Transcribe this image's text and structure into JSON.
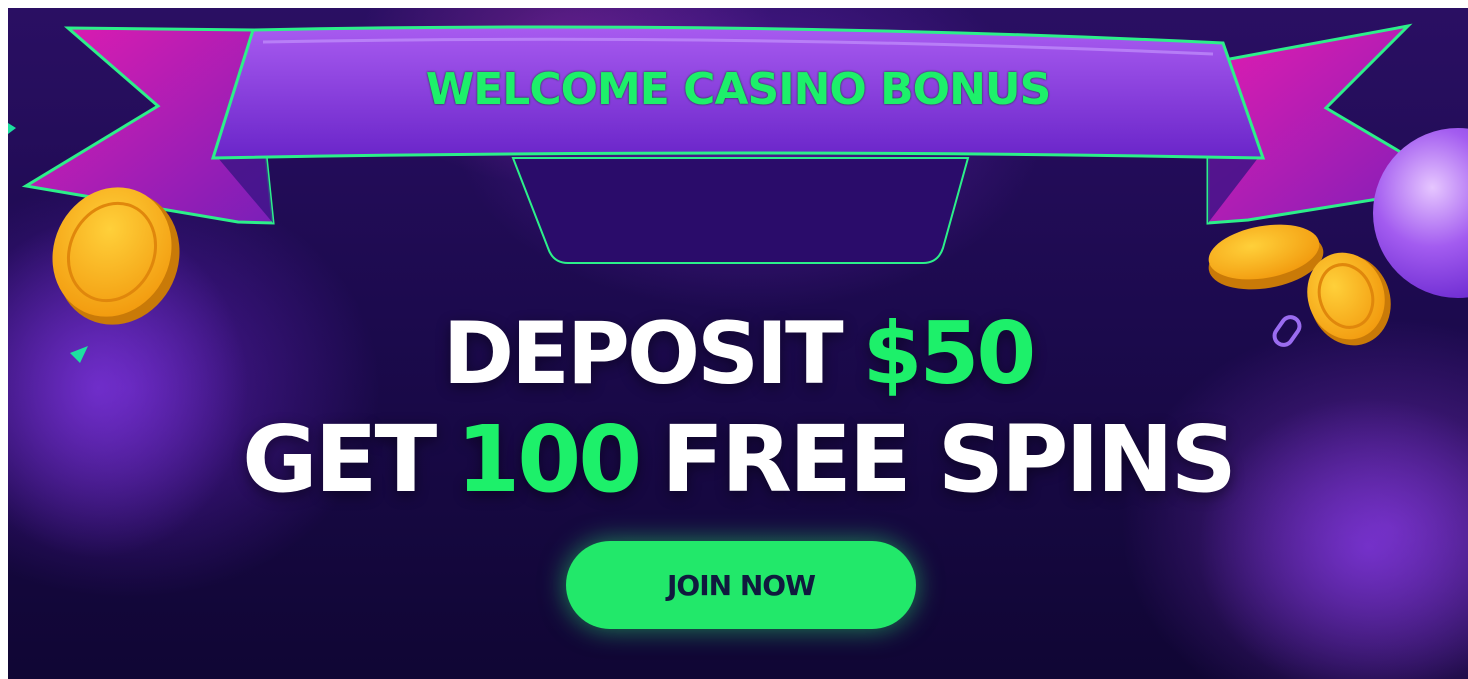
{
  "banner": {
    "ribbon_title": "WELCOME CASINO BONUS",
    "line1": {
      "prefix": "DEPOSIT",
      "highlight": "$50"
    },
    "line2": {
      "prefix": "GET",
      "highlight": "100",
      "suffix": "FREE SPINS"
    },
    "cta_label": "JOIN NOW"
  },
  "colors": {
    "background": "#1c0a4e",
    "accent_green": "#1df06a",
    "ribbon_purple": "#8a3be6",
    "ribbon_magenta": "#d21aa8",
    "coin_gold": "#ffb21a",
    "button_text": "#101a3e"
  },
  "icons": [
    "ribbon-banner",
    "gold-coin",
    "purple-orb",
    "green-triangle"
  ]
}
